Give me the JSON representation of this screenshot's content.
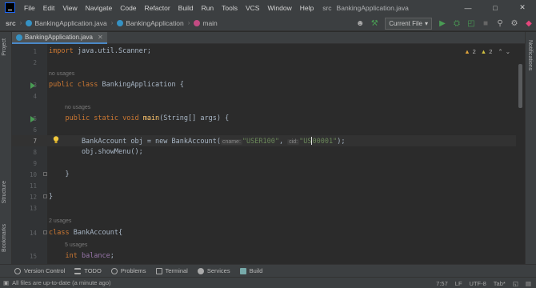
{
  "menubar": {
    "items": [
      "File",
      "Edit",
      "View",
      "Navigate",
      "Code",
      "Refactor",
      "Build",
      "Run",
      "Tools",
      "VCS",
      "Window",
      "Help"
    ],
    "project": "src",
    "file": "BankingApplication.java"
  },
  "navbar": {
    "crumbs": [
      "src",
      "BankingApplication.java",
      "BankingApplication",
      "main"
    ],
    "run_config": "Current File"
  },
  "tabs": [
    {
      "label": "BankingApplication.java"
    }
  ],
  "sidebar": {
    "left": [
      "Project",
      "Structure",
      "Bookmarks"
    ],
    "right": [
      "Notifications"
    ]
  },
  "inspections": {
    "warnings": "2",
    "weak_warnings": "2"
  },
  "editor": {
    "lines": [
      {
        "num": "1",
        "code": "import java.util.Scanner;"
      },
      {
        "num": "2",
        "code": ""
      },
      {
        "num": "3",
        "hint": "no usages",
        "code": "public class BankingApplication {"
      },
      {
        "num": "4",
        "code": ""
      },
      {
        "num": "5",
        "hint": "no usages",
        "code": "    public static void main(String[] args) {"
      },
      {
        "num": "6",
        "code": ""
      },
      {
        "num": "7",
        "code_a": "        BankAccount obj = new BankAccount(",
        "param1": "cname:",
        "arg1": "\"USER100\"",
        "param2": "cid:",
        "arg2a": "\"US",
        "arg2b": "00001\"",
        "code_b": ");"
      },
      {
        "num": "8",
        "code": "        obj.showMenu();"
      },
      {
        "num": "9",
        "code": ""
      },
      {
        "num": "10",
        "code": "    }"
      },
      {
        "num": "11",
        "code": ""
      },
      {
        "num": "12",
        "code": "}"
      },
      {
        "num": "13",
        "code": ""
      },
      {
        "num": "14",
        "hint": "2 usages",
        "code": "class BankAccount{"
      },
      {
        "num": "15",
        "hint": "5 usages",
        "code": "    int balance;"
      }
    ]
  },
  "toolwindows": [
    "Version Control",
    "TODO",
    "Problems",
    "Terminal",
    "Services",
    "Build"
  ],
  "status": {
    "message": "All files are up-to-date (a minute ago)",
    "position": "7:57",
    "line_sep": "LF",
    "encoding": "UTF-8",
    "indent": "Tab*"
  },
  "colors": {
    "accent": "#4a88c7",
    "run": "#499c54",
    "keyword": "#cc7832",
    "string": "#6a8759",
    "method": "#ffc66d"
  }
}
